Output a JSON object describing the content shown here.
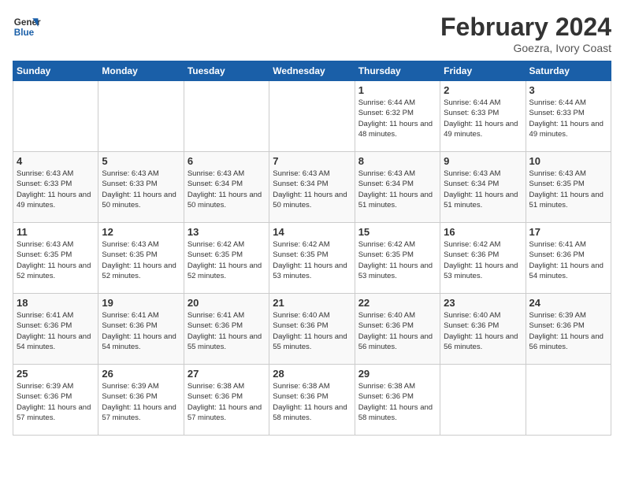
{
  "header": {
    "logo_general": "General",
    "logo_blue": "Blue",
    "month_year": "February 2024",
    "location": "Goezra, Ivory Coast"
  },
  "weekdays": [
    "Sunday",
    "Monday",
    "Tuesday",
    "Wednesday",
    "Thursday",
    "Friday",
    "Saturday"
  ],
  "weeks": [
    [
      {
        "day": "",
        "sunrise": "",
        "sunset": "",
        "daylight": ""
      },
      {
        "day": "",
        "sunrise": "",
        "sunset": "",
        "daylight": ""
      },
      {
        "day": "",
        "sunrise": "",
        "sunset": "",
        "daylight": ""
      },
      {
        "day": "",
        "sunrise": "",
        "sunset": "",
        "daylight": ""
      },
      {
        "day": "1",
        "sunrise": "Sunrise: 6:44 AM",
        "sunset": "Sunset: 6:32 PM",
        "daylight": "Daylight: 11 hours and 48 minutes."
      },
      {
        "day": "2",
        "sunrise": "Sunrise: 6:44 AM",
        "sunset": "Sunset: 6:33 PM",
        "daylight": "Daylight: 11 hours and 49 minutes."
      },
      {
        "day": "3",
        "sunrise": "Sunrise: 6:44 AM",
        "sunset": "Sunset: 6:33 PM",
        "daylight": "Daylight: 11 hours and 49 minutes."
      }
    ],
    [
      {
        "day": "4",
        "sunrise": "Sunrise: 6:43 AM",
        "sunset": "Sunset: 6:33 PM",
        "daylight": "Daylight: 11 hours and 49 minutes."
      },
      {
        "day": "5",
        "sunrise": "Sunrise: 6:43 AM",
        "sunset": "Sunset: 6:33 PM",
        "daylight": "Daylight: 11 hours and 50 minutes."
      },
      {
        "day": "6",
        "sunrise": "Sunrise: 6:43 AM",
        "sunset": "Sunset: 6:34 PM",
        "daylight": "Daylight: 11 hours and 50 minutes."
      },
      {
        "day": "7",
        "sunrise": "Sunrise: 6:43 AM",
        "sunset": "Sunset: 6:34 PM",
        "daylight": "Daylight: 11 hours and 50 minutes."
      },
      {
        "day": "8",
        "sunrise": "Sunrise: 6:43 AM",
        "sunset": "Sunset: 6:34 PM",
        "daylight": "Daylight: 11 hours and 51 minutes."
      },
      {
        "day": "9",
        "sunrise": "Sunrise: 6:43 AM",
        "sunset": "Sunset: 6:34 PM",
        "daylight": "Daylight: 11 hours and 51 minutes."
      },
      {
        "day": "10",
        "sunrise": "Sunrise: 6:43 AM",
        "sunset": "Sunset: 6:35 PM",
        "daylight": "Daylight: 11 hours and 51 minutes."
      }
    ],
    [
      {
        "day": "11",
        "sunrise": "Sunrise: 6:43 AM",
        "sunset": "Sunset: 6:35 PM",
        "daylight": "Daylight: 11 hours and 52 minutes."
      },
      {
        "day": "12",
        "sunrise": "Sunrise: 6:43 AM",
        "sunset": "Sunset: 6:35 PM",
        "daylight": "Daylight: 11 hours and 52 minutes."
      },
      {
        "day": "13",
        "sunrise": "Sunrise: 6:42 AM",
        "sunset": "Sunset: 6:35 PM",
        "daylight": "Daylight: 11 hours and 52 minutes."
      },
      {
        "day": "14",
        "sunrise": "Sunrise: 6:42 AM",
        "sunset": "Sunset: 6:35 PM",
        "daylight": "Daylight: 11 hours and 53 minutes."
      },
      {
        "day": "15",
        "sunrise": "Sunrise: 6:42 AM",
        "sunset": "Sunset: 6:35 PM",
        "daylight": "Daylight: 11 hours and 53 minutes."
      },
      {
        "day": "16",
        "sunrise": "Sunrise: 6:42 AM",
        "sunset": "Sunset: 6:36 PM",
        "daylight": "Daylight: 11 hours and 53 minutes."
      },
      {
        "day": "17",
        "sunrise": "Sunrise: 6:41 AM",
        "sunset": "Sunset: 6:36 PM",
        "daylight": "Daylight: 11 hours and 54 minutes."
      }
    ],
    [
      {
        "day": "18",
        "sunrise": "Sunrise: 6:41 AM",
        "sunset": "Sunset: 6:36 PM",
        "daylight": "Daylight: 11 hours and 54 minutes."
      },
      {
        "day": "19",
        "sunrise": "Sunrise: 6:41 AM",
        "sunset": "Sunset: 6:36 PM",
        "daylight": "Daylight: 11 hours and 54 minutes."
      },
      {
        "day": "20",
        "sunrise": "Sunrise: 6:41 AM",
        "sunset": "Sunset: 6:36 PM",
        "daylight": "Daylight: 11 hours and 55 minutes."
      },
      {
        "day": "21",
        "sunrise": "Sunrise: 6:40 AM",
        "sunset": "Sunset: 6:36 PM",
        "daylight": "Daylight: 11 hours and 55 minutes."
      },
      {
        "day": "22",
        "sunrise": "Sunrise: 6:40 AM",
        "sunset": "Sunset: 6:36 PM",
        "daylight": "Daylight: 11 hours and 56 minutes."
      },
      {
        "day": "23",
        "sunrise": "Sunrise: 6:40 AM",
        "sunset": "Sunset: 6:36 PM",
        "daylight": "Daylight: 11 hours and 56 minutes."
      },
      {
        "day": "24",
        "sunrise": "Sunrise: 6:39 AM",
        "sunset": "Sunset: 6:36 PM",
        "daylight": "Daylight: 11 hours and 56 minutes."
      }
    ],
    [
      {
        "day": "25",
        "sunrise": "Sunrise: 6:39 AM",
        "sunset": "Sunset: 6:36 PM",
        "daylight": "Daylight: 11 hours and 57 minutes."
      },
      {
        "day": "26",
        "sunrise": "Sunrise: 6:39 AM",
        "sunset": "Sunset: 6:36 PM",
        "daylight": "Daylight: 11 hours and 57 minutes."
      },
      {
        "day": "27",
        "sunrise": "Sunrise: 6:38 AM",
        "sunset": "Sunset: 6:36 PM",
        "daylight": "Daylight: 11 hours and 57 minutes."
      },
      {
        "day": "28",
        "sunrise": "Sunrise: 6:38 AM",
        "sunset": "Sunset: 6:36 PM",
        "daylight": "Daylight: 11 hours and 58 minutes."
      },
      {
        "day": "29",
        "sunrise": "Sunrise: 6:38 AM",
        "sunset": "Sunset: 6:36 PM",
        "daylight": "Daylight: 11 hours and 58 minutes."
      },
      {
        "day": "",
        "sunrise": "",
        "sunset": "",
        "daylight": ""
      },
      {
        "day": "",
        "sunrise": "",
        "sunset": "",
        "daylight": ""
      }
    ]
  ]
}
